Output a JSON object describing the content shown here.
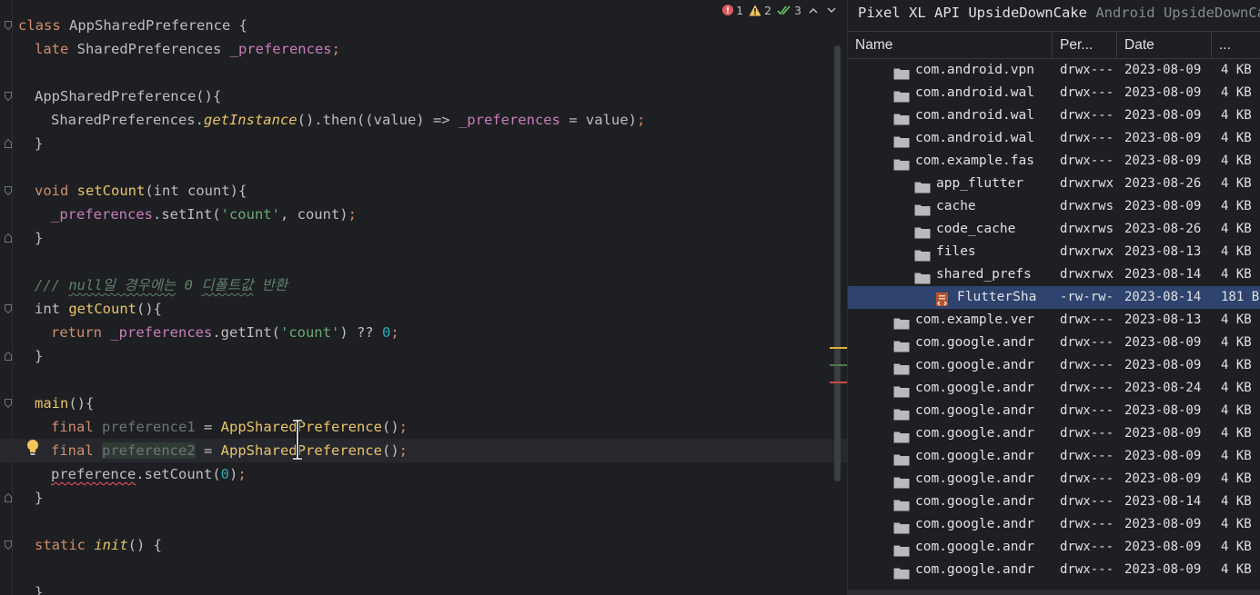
{
  "inspections": {
    "errors": "1",
    "warnings": "2",
    "weak_warnings": "3"
  },
  "code": [
    "class AppSharedPreference {",
    "late SharedPreferences _preferences;",
    "",
    "AppSharedPreference(){",
    "SharedPreferences.getInstance().then((value) => _preferences = value);",
    "}",
    "",
    "void setCount(int count){",
    "_preferences.setInt('count', count);",
    "}",
    "",
    "/// null일 경우에는 0 디폴트값 반환",
    "int getCount(){",
    "return _preferences.getInt('count') ?? 0;",
    "}",
    "",
    "main(){",
    "final preference1 = AppSharedPreference();",
    "final preference2 = AppSharedPreference();",
    "preference.setCount(0);",
    "}",
    "",
    "static init() {",
    "",
    "}"
  ],
  "explorer": {
    "device_name": "Pixel XL API UpsideDownCake",
    "device_subtitle": "Android UpsideDownCake",
    "columns": [
      "Name",
      "Per...",
      "Date",
      "..."
    ],
    "rows": [
      {
        "name": "com.android.vpn",
        "perm": "drwx---",
        "date": "2023-08-09",
        "size": "4 KB"
      },
      {
        "name": "com.android.wal",
        "perm": "drwx---",
        "date": "2023-08-09",
        "size": "4 KB"
      },
      {
        "name": "com.android.wal",
        "perm": "drwx---",
        "date": "2023-08-09",
        "size": "4 KB"
      },
      {
        "name": "com.android.wal",
        "perm": "drwx---",
        "date": "2023-08-09",
        "size": "4 KB"
      },
      {
        "name": "com.example.fas",
        "perm": "drwx---",
        "date": "2023-08-09",
        "size": "4 KB"
      },
      {
        "name": "app_flutter",
        "perm": "drwxrwx",
        "date": "2023-08-26",
        "size": "4 KB"
      },
      {
        "name": "cache",
        "perm": "drwxrws",
        "date": "2023-08-09",
        "size": "4 KB"
      },
      {
        "name": "code_cache",
        "perm": "drwxrws",
        "date": "2023-08-26",
        "size": "4 KB"
      },
      {
        "name": "files",
        "perm": "drwxrwx",
        "date": "2023-08-13",
        "size": "4 KB"
      },
      {
        "name": "shared_prefs",
        "perm": "drwxrwx",
        "date": "2023-08-14",
        "size": "4 KB"
      },
      {
        "name": "FlutterSha",
        "perm": "-rw-rw-",
        "date": "2023-08-14",
        "size": "181 B"
      },
      {
        "name": "com.example.ver",
        "perm": "drwx---",
        "date": "2023-08-13",
        "size": "4 KB"
      },
      {
        "name": "com.google.andr",
        "perm": "drwx---",
        "date": "2023-08-09",
        "size": "4 KB"
      },
      {
        "name": "com.google.andr",
        "perm": "drwx---",
        "date": "2023-08-09",
        "size": "4 KB"
      },
      {
        "name": "com.google.andr",
        "perm": "drwx---",
        "date": "2023-08-24",
        "size": "4 KB"
      },
      {
        "name": "com.google.andr",
        "perm": "drwx---",
        "date": "2023-08-09",
        "size": "4 KB"
      },
      {
        "name": "com.google.andr",
        "perm": "drwx---",
        "date": "2023-08-09",
        "size": "4 KB"
      },
      {
        "name": "com.google.andr",
        "perm": "drwx---",
        "date": "2023-08-09",
        "size": "4 KB"
      },
      {
        "name": "com.google.andr",
        "perm": "drwx---",
        "date": "2023-08-09",
        "size": "4 KB"
      },
      {
        "name": "com.google.andr",
        "perm": "drwx---",
        "date": "2023-08-14",
        "size": "4 KB"
      },
      {
        "name": "com.google.andr",
        "perm": "drwx---",
        "date": "2023-08-09",
        "size": "4 KB"
      },
      {
        "name": "com.google.andr",
        "perm": "drwx---",
        "date": "2023-08-09",
        "size": "4 KB"
      },
      {
        "name": "com.google.andr",
        "perm": "drwx---",
        "date": "2023-08-09",
        "size": "4 KB"
      }
    ]
  }
}
